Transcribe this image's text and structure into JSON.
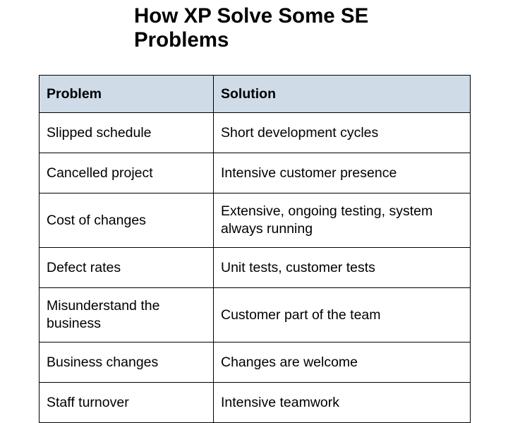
{
  "slide": {
    "title": "How XP Solve Some SE Problems",
    "title_line1": "How XP Solve Some SE",
    "title_line2": "Problems",
    "background_color": "#ffffff",
    "text_color": "#000000"
  },
  "table": {
    "header_background_color": "#cfdbe7",
    "border_color": "#000000",
    "columns": [
      {
        "label": "Problem"
      },
      {
        "label": "Solution"
      }
    ],
    "rows": [
      {
        "problem": "Slipped schedule",
        "solution": "Short development cycles",
        "tall": false
      },
      {
        "problem": "Cancelled project",
        "solution": "Intensive customer presence",
        "tall": false
      },
      {
        "problem": "Cost of changes",
        "solution": "Extensive, ongoing testing, system always running",
        "tall": true
      },
      {
        "problem": "Defect rates",
        "solution": "Unit tests, customer tests",
        "tall": false
      },
      {
        "problem": "Misunderstand the business",
        "solution": "Customer part of the team",
        "tall": true
      },
      {
        "problem": "Business changes",
        "solution": "Changes are welcome",
        "tall": false
      },
      {
        "problem": "Staff turnover",
        "solution": "Intensive teamwork",
        "tall": false
      }
    ]
  }
}
